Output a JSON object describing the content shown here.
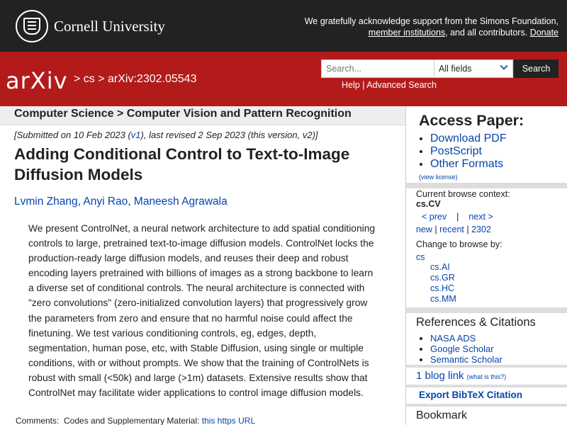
{
  "topbar": {
    "university": "Cornell University",
    "support_text": "We gratefully acknowledge support from the Simons Foundation,",
    "member_link": "member institutions",
    "support_tail": ", and all contributors.",
    "donate_link": "Donate"
  },
  "header": {
    "logo": "arXiv",
    "crumb_cs": "cs",
    "crumb_id": "arXiv:2302.05543",
    "search_placeholder": "Search...",
    "search_field": "All fields",
    "search_button": "Search",
    "help_link": "Help",
    "advanced_link": "Advanced Search"
  },
  "main": {
    "subject": "Computer Science > Computer Vision and Pattern Recognition",
    "dateline_pre": "[Submitted on 10 Feb 2023 (",
    "v1": "v1",
    "dateline_post": "), last revised 2 Sep 2023 (this version, v2)]",
    "title": "Adding Conditional Control to Text-to-Image Diffusion Models",
    "authors": [
      "Lvmin Zhang",
      "Anyi Rao",
      "Maneesh Agrawala"
    ],
    "abstract": "We present ControlNet, a neural network architecture to add spatial conditioning controls to large, pretrained text-to-image diffusion models. ControlNet locks the production-ready large diffusion models, and reuses their deep and robust encoding layers pretrained with billions of images as a strong backbone to learn a diverse set of conditional controls. The neural architecture is connected with \"zero convolutions\" (zero-initialized convolution layers) that progressively grow the parameters from zero and ensure that no harmful noise could affect the finetuning. We test various conditioning controls, eg, edges, depth, segmentation, human pose, etc, with Stable Diffusion, using single or multiple conditions, with or without prompts. We show that the training of ControlNets is robust with small (<50k) and large (>1m) datasets. Extensive results show that ControlNet may facilitate wider applications to control image diffusion models.",
    "comments_label": "Comments:",
    "comments_text": "Codes and Supplementary Material: ",
    "comments_link": "this https URL"
  },
  "sidebar": {
    "access_title": "Access Paper:",
    "access_links": [
      "Download PDF",
      "PostScript",
      "Other Formats"
    ],
    "view_license": "(view license)",
    "context_label": "Current browse context:",
    "context_value": "cs.CV",
    "prev": "< prev",
    "pipe": "|",
    "next": "next >",
    "new": "new",
    "recent": "recent",
    "period": "2302",
    "change_label": "Change to browse by:",
    "cs": "cs",
    "cs_sub": [
      "cs.AI",
      "cs.GR",
      "cs.HC",
      "cs.MM"
    ],
    "refs_title": "References & Citations",
    "refs_links": [
      "NASA ADS",
      "Google Scholar",
      "Semantic Scholar"
    ],
    "blog_link": "1 blog link",
    "blog_what": "(what is this?)",
    "bibtex": "Export BibTeX Citation",
    "bookmark": "Bookmark"
  },
  "colors": {
    "brand_red": "#b31b1b",
    "topbar": "#222222",
    "link": "#0645ad"
  }
}
